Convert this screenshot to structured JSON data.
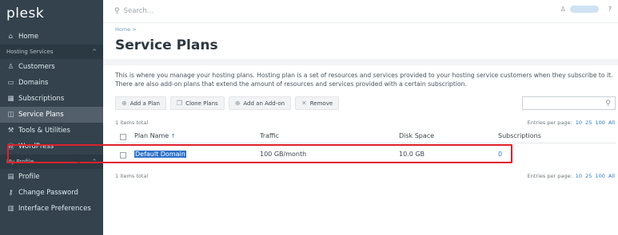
{
  "app": {
    "logo": "plesk"
  },
  "sidebar": {
    "home": "Home",
    "sections": [
      {
        "label": "Hosting Services",
        "chevron": "^"
      },
      {
        "label": "My Profile",
        "chevron": "^"
      }
    ],
    "hosting_items": [
      {
        "label": "Customers",
        "icon": "person-icon",
        "glyph": "♙"
      },
      {
        "label": "Domains",
        "icon": "monitor-icon",
        "glyph": "▭"
      },
      {
        "label": "Subscriptions",
        "icon": "grid-icon",
        "glyph": "▦"
      },
      {
        "label": "Service Plans",
        "icon": "plans-icon",
        "glyph": "◫",
        "active": true
      },
      {
        "label": "Tools & Utilities",
        "icon": "tools-icon",
        "glyph": "⚒"
      },
      {
        "label": "WordPress",
        "icon": "wordpress-icon",
        "glyph": "Ⓦ"
      }
    ],
    "profile_items": [
      {
        "label": "Profile",
        "icon": "profile-card-icon",
        "glyph": "▤"
      },
      {
        "label": "Change Password",
        "icon": "key-icon",
        "glyph": "⚷"
      },
      {
        "label": "Interface Preferences",
        "icon": "layout-icon",
        "glyph": "▥"
      }
    ],
    "collapse_glyph": "‹"
  },
  "topbar": {
    "search_placeholder": "Search...",
    "help_glyph": "?"
  },
  "main": {
    "breadcrumb": "Home >",
    "title": "Service Plans",
    "description": "This is where you manage your hosting plans. Hosting plan is a set of resources and services provided to your hosting service customers when they subscribe to it. There are also add-on plans that extend the amount of resources and services provided with a certain subscription.",
    "buttons": [
      {
        "label": "Add a Plan",
        "icon": "add-plan-icon",
        "glyph": "⊕"
      },
      {
        "label": "Clone Plans",
        "icon": "clone-icon",
        "glyph": "❐"
      },
      {
        "label": "Add an Add-on",
        "icon": "add-addon-icon",
        "glyph": "⊕"
      },
      {
        "label": "Remove",
        "icon": "remove-icon",
        "glyph": "✕"
      }
    ],
    "items_total": "1 items total",
    "entries_label": "Entries per page:",
    "entries_options": [
      "10",
      "25",
      "100",
      "All"
    ],
    "columns": {
      "plan_name": "Plan Name",
      "sort_glyph": "↑",
      "traffic": "Traffic",
      "disk_space": "Disk Space",
      "subscriptions": "Subscriptions"
    },
    "rows": [
      {
        "plan_name": "Default Domain",
        "traffic": "100 GB/month",
        "disk_space": "10.0 GB",
        "subscriptions": "0"
      }
    ]
  },
  "colors": {
    "sidebar_bg": "#33424d",
    "active_item": "#53606b",
    "link": "#2f78c4",
    "highlight_border": "#e0202a"
  }
}
